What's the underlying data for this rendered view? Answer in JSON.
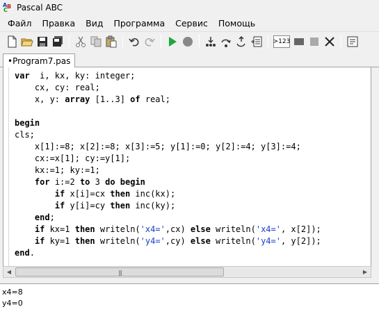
{
  "window": {
    "title": "Pascal ABC",
    "icon_letters": [
      "A",
      "B",
      "C"
    ],
    "icon": "pascal-abc-app-icon"
  },
  "menu": [
    "Файл",
    "Правка",
    "Вид",
    "Программа",
    "Сервис",
    "Помощь"
  ],
  "toolbar": {
    "icons": [
      "new-file-icon",
      "open-folder-icon",
      "save-icon",
      "save-all-icon",
      "cut-icon",
      "copy-icon",
      "paste-icon",
      "undo-icon",
      "redo-icon",
      "run-icon",
      "stop-icon",
      "step-into-icon",
      "step-over-icon",
      "step-out-icon",
      "watch-list-icon",
      "counter-icon",
      "breakpoint-icon",
      "close-icon",
      "tool-icon"
    ],
    "counter_label": ">123"
  },
  "tab": {
    "label": "•Program7.pas"
  },
  "code": [
    [
      [
        "kw",
        "var"
      ],
      [
        "",
        "  i, kx, ky: integer;"
      ]
    ],
    [
      [
        "",
        "    cx, cy: real;"
      ]
    ],
    [
      [
        "",
        "    x, y: "
      ],
      [
        "kw",
        "array"
      ],
      [
        "",
        " [1..3] "
      ],
      [
        "kw",
        "of"
      ],
      [
        "",
        " real;"
      ]
    ],
    [
      [
        "",
        ""
      ]
    ],
    [
      [
        "kw",
        "begin"
      ]
    ],
    [
      [
        "",
        "cls;"
      ]
    ],
    [
      [
        "",
        "    x[1]:=8; x[2]:=8; x[3]:=5; y[1]:=0; y[2]:=4; y[3]:=4;"
      ]
    ],
    [
      [
        "",
        "    cx:=x[1]; cy:=y[1];"
      ]
    ],
    [
      [
        "",
        "    kx:=1; ky:=1;"
      ]
    ],
    [
      [
        "",
        "    "
      ],
      [
        "kw",
        "for"
      ],
      [
        "",
        " i:=2 "
      ],
      [
        "kw",
        "to"
      ],
      [
        "",
        " 3 "
      ],
      [
        "kw",
        "do"
      ],
      [
        "",
        " "
      ],
      [
        "kw",
        "begin"
      ]
    ],
    [
      [
        "",
        "        "
      ],
      [
        "kw",
        "if"
      ],
      [
        "",
        " x[i]=cx "
      ],
      [
        "kw",
        "then"
      ],
      [
        "",
        " inc(kx);"
      ]
    ],
    [
      [
        "",
        "        "
      ],
      [
        "kw",
        "if"
      ],
      [
        "",
        " y[i]=cy "
      ],
      [
        "kw",
        "then"
      ],
      [
        "",
        " inc(ky);"
      ]
    ],
    [
      [
        "",
        "    "
      ],
      [
        "kw",
        "end"
      ],
      [
        "",
        ";"
      ]
    ],
    [
      [
        "",
        "    "
      ],
      [
        "kw",
        "if"
      ],
      [
        "",
        " kx=1 "
      ],
      [
        "kw",
        "then"
      ],
      [
        "",
        " writeln("
      ],
      [
        "str",
        "'x4='"
      ],
      [
        "",
        ",cx) "
      ],
      [
        "kw",
        "else"
      ],
      [
        "",
        " writeln("
      ],
      [
        "str",
        "'x4='"
      ],
      [
        "",
        ", x[2]);"
      ]
    ],
    [
      [
        "",
        "    "
      ],
      [
        "kw",
        "if"
      ],
      [
        "",
        " ky=1 "
      ],
      [
        "kw",
        "then"
      ],
      [
        "",
        " writeln("
      ],
      [
        "str",
        "'y4='"
      ],
      [
        "",
        ",cy) "
      ],
      [
        "kw",
        "else"
      ],
      [
        "",
        " writeln("
      ],
      [
        "str",
        "'y4='"
      ],
      [
        "",
        ", y[2]);"
      ]
    ],
    [
      [
        "kw",
        "end"
      ],
      [
        "",
        "."
      ]
    ]
  ],
  "output": [
    "x4=8",
    "y4=0"
  ],
  "colors": {
    "keyword": "#000000",
    "string": "#1a3fc8",
    "background": "#f0f0f0"
  }
}
